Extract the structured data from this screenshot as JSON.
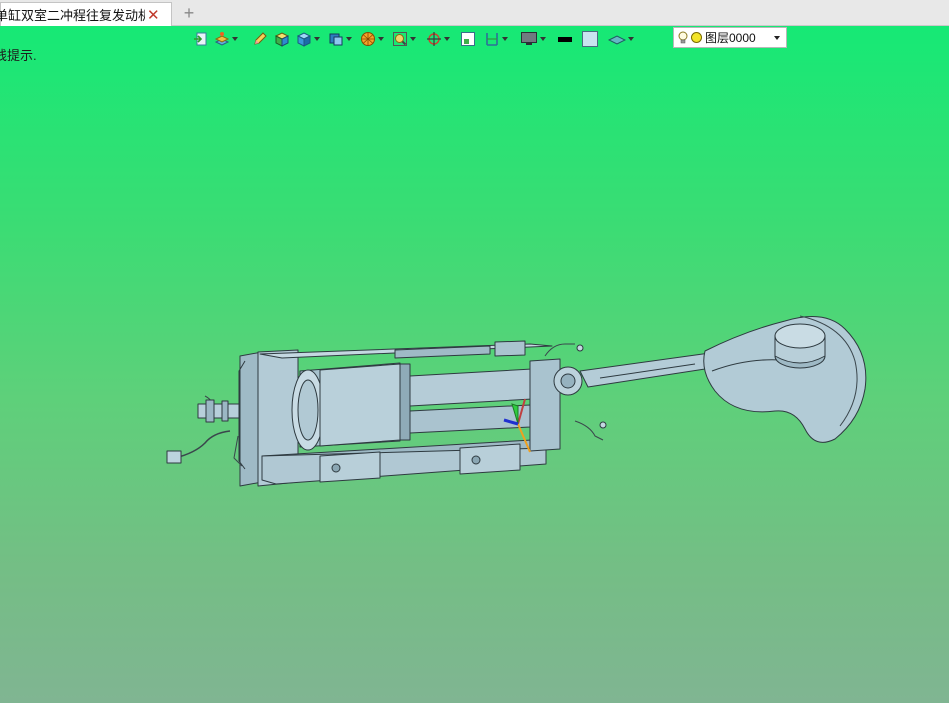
{
  "tab": {
    "title": "单缸双室二冲程往复发动机]",
    "close_label": "✕",
    "add_label": "+"
  },
  "viewport": {
    "hint_text": "线提示."
  },
  "toolbar": {
    "icons": [
      "exit-sketch-icon",
      "layer-manager-icon",
      "pencil-icon",
      "wireframe-box-icon",
      "shaded-box-icon",
      "view-cube-icon",
      "sphere-render-icon",
      "zoom-fit-icon",
      "rotate-axis-icon",
      "fit-frame-icon",
      "section-icon",
      "display-mode-icon",
      "line-color-swatch",
      "face-color-swatch",
      "plane-icon"
    ],
    "layer_select": {
      "value": "图层0000"
    }
  },
  "colors": {
    "viewport_top": "#16e975",
    "viewport_bottom": "#80b592",
    "model_body": "#a9c4d0",
    "model_outline": "#2e3a40"
  }
}
